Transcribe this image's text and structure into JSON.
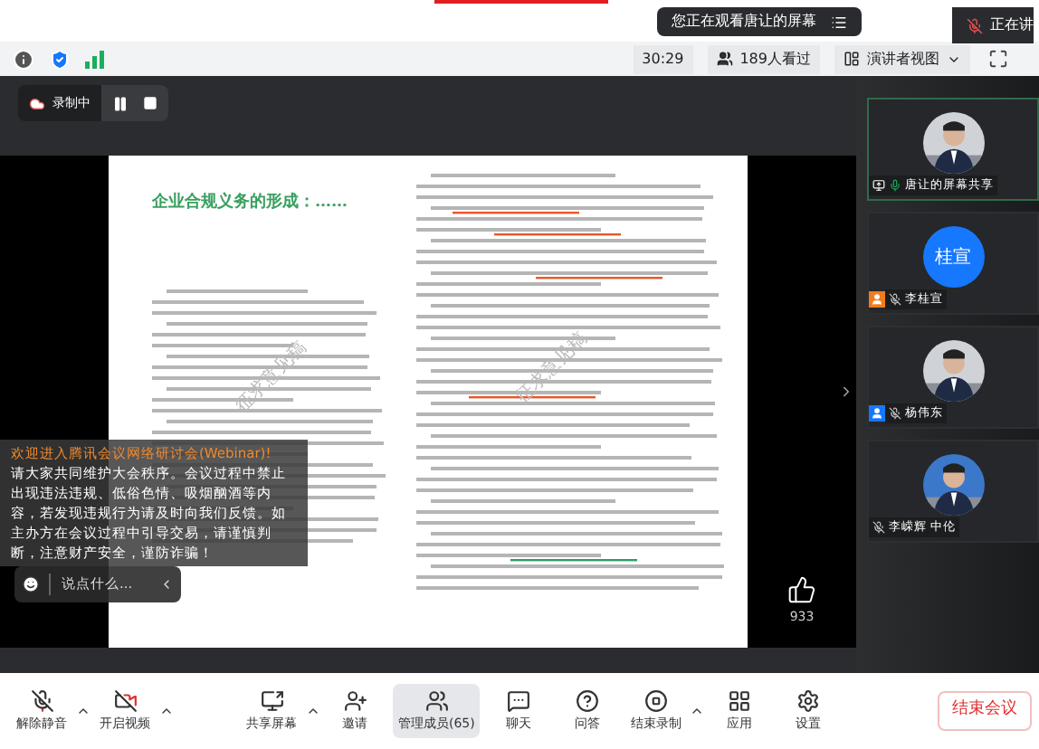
{
  "top_notice": {
    "text": "您正在观看唐让的屏幕"
  },
  "speaking": {
    "text": "正在讲"
  },
  "toolbar": {
    "timer": "30:29",
    "viewers": "189人看过",
    "view_mode": "演讲者视图"
  },
  "recording": {
    "label": "录制中"
  },
  "document": {
    "title": "企业合规义务的形成：……",
    "watermarks": [
      "征求意见稿",
      "征求意见稿"
    ]
  },
  "likes": {
    "count": "933"
  },
  "chat": {
    "welcome": "欢迎进入腾讯会议网络研讨会(Webinar)!",
    "notice": "请大家共同维护大会秩序。会议过程中禁止出现违法违规、低俗色情、吸烟酗酒等内容，若发现违规行为请及时向我们反馈。如主办方在会议过程中引导交易，请谨慎判断，注意财产安全，谨防诈骗！",
    "placeholder": "说点什么..."
  },
  "participants": [
    {
      "name": "唐让的屏幕共享",
      "selected": true,
      "muted": false,
      "sharing": true
    },
    {
      "name": "李桂宣",
      "initials": "桂宣",
      "selected": false,
      "muted": true,
      "sharing": false,
      "color": "#f07c1b"
    },
    {
      "name": "杨伟东",
      "selected": false,
      "muted": true,
      "sharing": false,
      "color": "#1677ff"
    },
    {
      "name": "李嵘辉 中伦",
      "selected": false,
      "muted": true,
      "sharing": false
    }
  ],
  "controls": [
    {
      "kind": "mic",
      "label": "解除静音",
      "caret": true,
      "selected": false
    },
    {
      "kind": "video",
      "label": "开启视频",
      "caret": true,
      "selected": false
    },
    {
      "kind": "share",
      "label": "共享屏幕",
      "caret": true,
      "selected": false
    },
    {
      "kind": "invite",
      "label": "邀请",
      "caret": false,
      "selected": false
    },
    {
      "kind": "members",
      "label": "管理成员(65)",
      "caret": false,
      "selected": true
    },
    {
      "kind": "chat",
      "label": "聊天",
      "caret": false,
      "selected": false
    },
    {
      "kind": "qa",
      "label": "问答",
      "caret": false,
      "selected": false
    },
    {
      "kind": "record",
      "label": "结束录制",
      "caret": true,
      "selected": false
    },
    {
      "kind": "apps",
      "label": "应用",
      "caret": false,
      "selected": false
    },
    {
      "kind": "settings",
      "label": "设置",
      "caret": false,
      "selected": false
    }
  ],
  "end_button": "结束会议"
}
